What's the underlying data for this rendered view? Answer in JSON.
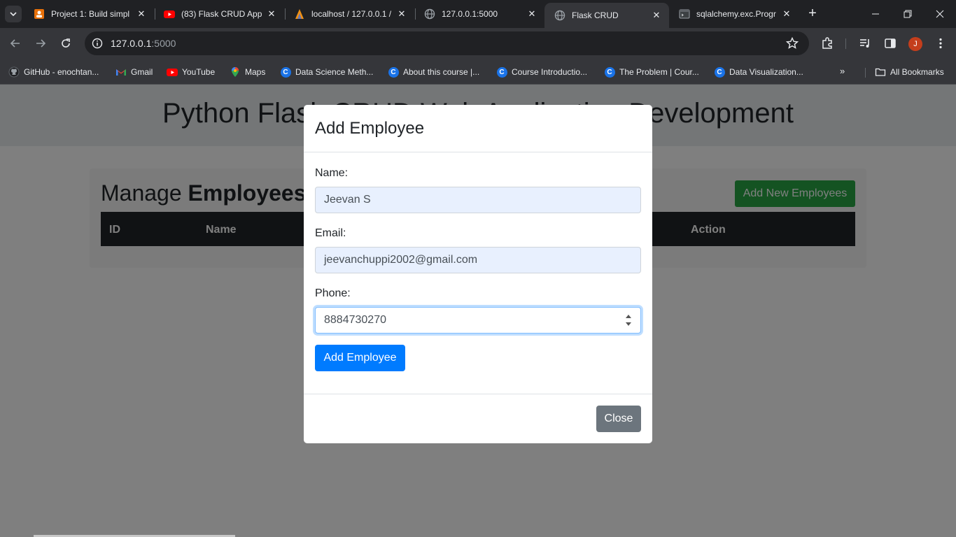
{
  "browser": {
    "tabs": [
      {
        "title": "Project 1: Build simpl",
        "icon": "coursera-project-icon"
      },
      {
        "title": "(83) Flask CRUD App",
        "icon": "youtube-icon"
      },
      {
        "title": "localhost / 127.0.0.1 /",
        "icon": "phpmyadmin-icon"
      },
      {
        "title": "127.0.0.1:5000",
        "icon": "globe-icon"
      },
      {
        "title": "Flask CRUD",
        "icon": "globe-icon",
        "active": true
      },
      {
        "title": "sqlalchemy.exc.Progr",
        "icon": "terminal-icon"
      }
    ],
    "url_host": "127.0.0.1",
    "url_port": ":5000",
    "profile_initial": "J",
    "bookmarks": [
      {
        "label": "GitHub - enochtan...",
        "icon": "github-icon"
      },
      {
        "label": "Gmail",
        "icon": "gmail-icon"
      },
      {
        "label": "YouTube",
        "icon": "youtube-icon"
      },
      {
        "label": "Maps",
        "icon": "maps-icon"
      },
      {
        "label": "Data Science Meth...",
        "icon": "coursera-icon"
      },
      {
        "label": "About this course |...",
        "icon": "coursera-icon"
      },
      {
        "label": "Course Introductio...",
        "icon": "coursera-icon"
      },
      {
        "label": "The Problem | Cour...",
        "icon": "coursera-icon"
      },
      {
        "label": "Data Visualization...",
        "icon": "coursera-icon"
      }
    ],
    "bookmarks_more": "»",
    "all_bookmarks": "All Bookmarks"
  },
  "page": {
    "heading": "Python Flask CRUD Web Application Development",
    "manage_prefix": "Manage ",
    "manage_bold": "Employees",
    "add_new_button": "Add New Employees",
    "table_headers": [
      "ID",
      "Name",
      "Action"
    ]
  },
  "modal": {
    "title": "Add Employee",
    "name_label": "Name:",
    "name_value": "Jeevan S",
    "email_label": "Email:",
    "email_value": "jeevanchuppi2002@gmail.com",
    "phone_label": "Phone:",
    "phone_value": "8884730270",
    "submit_label": "Add Employee",
    "close_label": "Close"
  },
  "colors": {
    "primary": "#007bff",
    "success": "#28a745",
    "secondary": "#6c757d",
    "table_dark": "#212529"
  }
}
